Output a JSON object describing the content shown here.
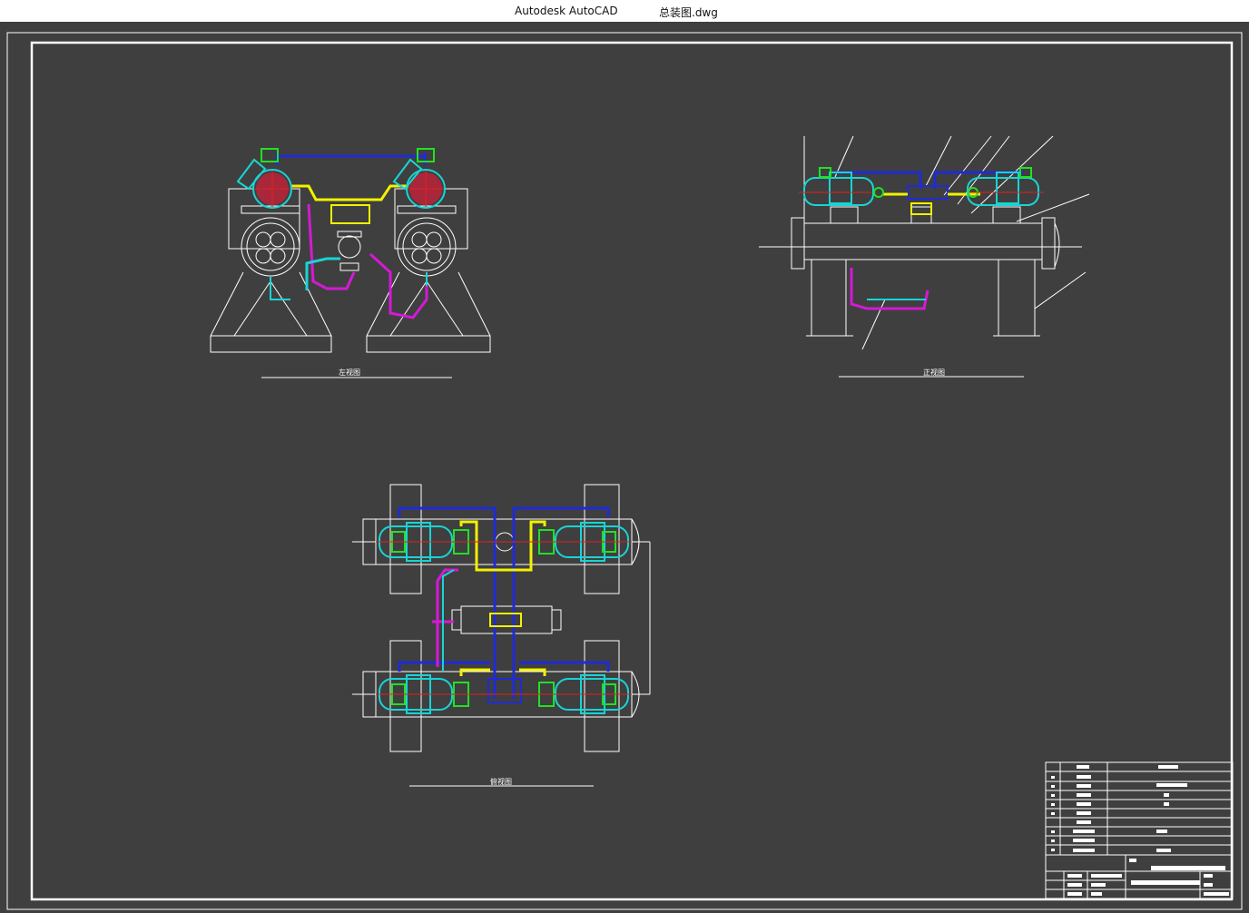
{
  "window": {
    "app_name": "Autodesk AutoCAD",
    "file_name": "总装图.dwg"
  },
  "views": {
    "left_view_caption": "左视图",
    "front_view_caption": "正视图",
    "top_view_caption": "俯视图"
  },
  "colors": {
    "background": "#3f3f3f",
    "frame": "#ffffff",
    "pipe_blue": "#1f2bd6",
    "pipe_yellow": "#f2f200",
    "pipe_magenta": "#d41ad4",
    "pipe_cyan": "#19d4d4",
    "part_green": "#22e022",
    "axis_red": "#e02020"
  }
}
